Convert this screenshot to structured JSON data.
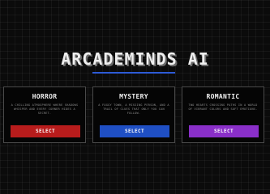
{
  "app": {
    "title": "ARCADEMINDS AI"
  },
  "cards": [
    {
      "title": "HORROR",
      "description": "A chilling atmosphere where shadows whisper and every corner hides a secret.",
      "button_label": "SELECT",
      "button_color": "#b81c1c"
    },
    {
      "title": "MYSTERY",
      "description": "A foggy town, a missing person, and a trail of clues that only you can follow.",
      "button_label": "SELECT",
      "button_color": "#1f4fc4"
    },
    {
      "title": "ROMANTIC",
      "description": "Two hearts crossing paths in a world of vibrant colors and soft emotions.",
      "button_label": "SELECT",
      "button_color": "#8a2fc9"
    }
  ],
  "colors": {
    "background": "#0b0b0b",
    "accent_underline": "#2d5bd6",
    "card_border": "#4a4a4a"
  }
}
